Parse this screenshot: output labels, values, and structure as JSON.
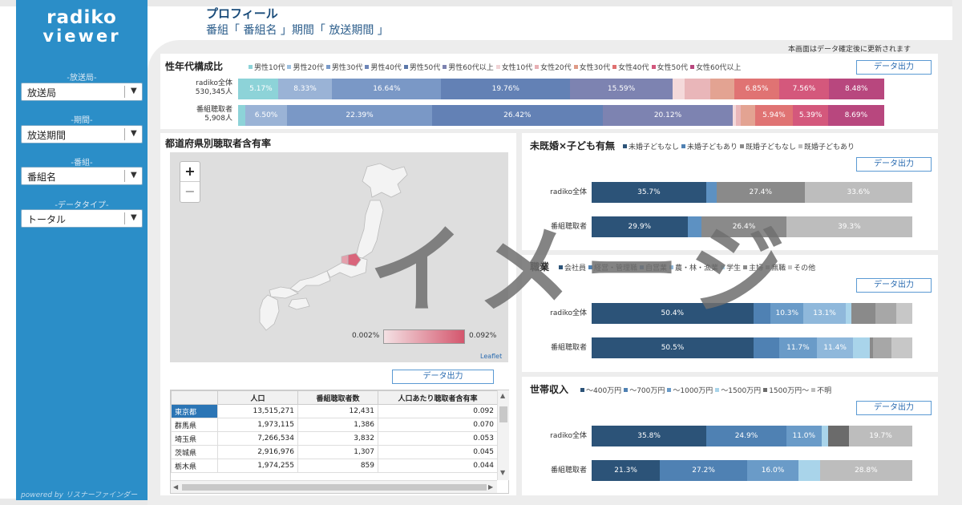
{
  "sidebar": {
    "logo_line1": "radiko",
    "logo_line2": "viewer",
    "filters": [
      {
        "label": "-放送局-",
        "value": "放送局"
      },
      {
        "label": "-期間-",
        "value": "放送期間"
      },
      {
        "label": "-番組-",
        "value": "番組名"
      },
      {
        "label": "-データタイプ-",
        "value": "トータル"
      }
    ],
    "powered_by": "powered by リスナーファインダー"
  },
  "header": {
    "title": "プロフィール",
    "subtitle": "番組「 番組名 」期間「 放送期間 」",
    "update_note": "本画面はデータ確定後に更新されます"
  },
  "export_label": "データ出力",
  "gender_age": {
    "title": "性年代構成比",
    "legend": [
      {
        "label": "男性10代",
        "color": "#8dd3d8"
      },
      {
        "label": "男性20代",
        "color": "#9ec1e0"
      },
      {
        "label": "男性30代",
        "color": "#7a9bc9"
      },
      {
        "label": "男性40代",
        "color": "#6e86b8"
      },
      {
        "label": "男性50代",
        "color": "#5c78aa"
      },
      {
        "label": "男性60代以上",
        "color": "#7c82b0"
      },
      {
        "label": "女性10代",
        "color": "#f0d3d5"
      },
      {
        "label": "女性20代",
        "color": "#e7b0b4"
      },
      {
        "label": "女性30代",
        "color": "#df9a86"
      },
      {
        "label": "女性40代",
        "color": "#e07070"
      },
      {
        "label": "女性50代",
        "color": "#d2567c"
      },
      {
        "label": "女性60代以上",
        "color": "#b8477e"
      }
    ],
    "rows": [
      {
        "label1": "radiko全体",
        "label2": "530,345人",
        "segments": [
          {
            "value": 0.9,
            "label": "",
            "color": "#8dd3d8"
          },
          {
            "value": 5.17,
            "label": "5.17%",
            "color": "#8dd3d8"
          },
          {
            "value": 8.33,
            "label": "8.33%",
            "color": "#9ab3d6"
          },
          {
            "value": 16.64,
            "label": "16.64%",
            "color": "#7a98c6"
          },
          {
            "value": 19.76,
            "label": "19.76%",
            "color": "#6381b5"
          },
          {
            "value": 15.59,
            "label": "15.59%",
            "color": "#7d83b1"
          },
          {
            "value": 1.9,
            "label": "",
            "color": "#f4d9da"
          },
          {
            "value": 3.9,
            "label": "",
            "color": "#e9b6b9"
          },
          {
            "value": 3.7,
            "label": "",
            "color": "#e3a392"
          },
          {
            "value": 6.85,
            "label": "6.85%",
            "color": "#e07373"
          },
          {
            "value": 7.56,
            "label": "7.56%",
            "color": "#d4587c"
          },
          {
            "value": 8.48,
            "label": "8.48%",
            "color": "#b8477e"
          }
        ]
      },
      {
        "label1": "番組聴取者",
        "label2": "5,908人",
        "segments": [
          {
            "value": 1.1,
            "label": "",
            "color": "#8dd3d8"
          },
          {
            "value": 6.5,
            "label": "6.50%",
            "color": "#9ab3d6"
          },
          {
            "value": 22.39,
            "label": "22.39%",
            "color": "#7a98c6"
          },
          {
            "value": 26.42,
            "label": "26.42%",
            "color": "#6381b5"
          },
          {
            "value": 20.12,
            "label": "20.12%",
            "color": "#7d83b1"
          },
          {
            "value": 0.5,
            "label": "",
            "color": "#f4d9da"
          },
          {
            "value": 0.7,
            "label": "",
            "color": "#e9b6b9"
          },
          {
            "value": 2.2,
            "label": "",
            "color": "#e3a392"
          },
          {
            "value": 5.94,
            "label": "5.94%",
            "color": "#e07373"
          },
          {
            "value": 5.39,
            "label": "5.39%",
            "color": "#d4587c"
          },
          {
            "value": 8.69,
            "label": "8.69%",
            "color": "#b8477e"
          }
        ]
      }
    ]
  },
  "prefecture": {
    "title": "都道府県別聴取者含有率",
    "scale_min": "0.002%",
    "scale_max": "0.092%",
    "leaflet": "Leaflet",
    "zoom_in": "+",
    "zoom_out": "−",
    "table_headers": [
      "",
      "人口",
      "番組聴取者数",
      "人口あたり聴取者含有率"
    ],
    "table_rows": [
      [
        "東京都",
        "13,515,271",
        "12,431",
        "0.092"
      ],
      [
        "群馬県",
        "1,973,115",
        "1,386",
        "0.070"
      ],
      [
        "埼玉県",
        "7,266,534",
        "3,832",
        "0.053"
      ],
      [
        "茨城県",
        "2,916,976",
        "1,307",
        "0.045"
      ],
      [
        "栃木県",
        "1,974,255",
        "859",
        "0.044"
      ]
    ]
  },
  "marital": {
    "title": "未既婚×子ども有無",
    "legend": [
      {
        "label": "未婚子どもなし",
        "color": "#2c5378"
      },
      {
        "label": "未婚子どもあり",
        "color": "#4f81b3"
      },
      {
        "label": "既婚子どもなし",
        "color": "#8a8a8a"
      },
      {
        "label": "既婚子どもあり",
        "color": "#bdbdbd"
      }
    ],
    "rows": [
      {
        "label": "radiko全体",
        "segments": [
          {
            "value": 35.7,
            "label": "35.7%",
            "color": "#2c5378"
          },
          {
            "value": 3.3,
            "label": "",
            "color": "#5d91c2"
          },
          {
            "value": 27.4,
            "label": "27.4%",
            "color": "#8a8a8a"
          },
          {
            "value": 33.6,
            "label": "33.6%",
            "color": "#bdbdbd"
          }
        ]
      },
      {
        "label": "番組聴取者",
        "segments": [
          {
            "value": 29.9,
            "label": "29.9%",
            "color": "#2c5378"
          },
          {
            "value": 4.4,
            "label": "",
            "color": "#5d91c2"
          },
          {
            "value": 26.4,
            "label": "26.4%",
            "color": "#8a8a8a"
          },
          {
            "value": 39.3,
            "label": "39.3%",
            "color": "#bdbdbd"
          }
        ]
      }
    ]
  },
  "occupation": {
    "title": "職業",
    "legend": [
      {
        "label": "会社員",
        "color": "#2c5378"
      },
      {
        "label": "経営・管理職",
        "color": "#4f81b3"
      },
      {
        "label": "自営業",
        "color": "#6a9bc8"
      },
      {
        "label": "農・林・漁業",
        "color": "#8fb8db"
      },
      {
        "label": "学生",
        "color": "#a9d4ea"
      },
      {
        "label": "主婦",
        "color": "#8a8a8a"
      },
      {
        "label": "無職",
        "color": "#a7a7a7"
      },
      {
        "label": "その他",
        "color": "#c7c7c7"
      }
    ],
    "rows": [
      {
        "label": "radiko全体",
        "segments": [
          {
            "value": 50.4,
            "label": "50.4%",
            "color": "#2c5378"
          },
          {
            "value": 5.4,
            "label": "",
            "color": "#4f81b3"
          },
          {
            "value": 10.3,
            "label": "10.3%",
            "color": "#6a9bc8"
          },
          {
            "value": 13.1,
            "label": "13.1%",
            "color": "#8fb8db"
          },
          {
            "value": 1.8,
            "label": "",
            "color": "#a9d4ea"
          },
          {
            "value": 7.5,
            "label": "",
            "color": "#8a8a8a"
          },
          {
            "value": 6.5,
            "label": "",
            "color": "#a7a7a7"
          },
          {
            "value": 5.0,
            "label": "",
            "color": "#c7c7c7"
          }
        ]
      },
      {
        "label": "番組聴取者",
        "segments": [
          {
            "value": 50.5,
            "label": "50.5%",
            "color": "#2c5378"
          },
          {
            "value": 8.0,
            "label": "",
            "color": "#4f81b3"
          },
          {
            "value": 11.7,
            "label": "11.7%",
            "color": "#6a9bc8"
          },
          {
            "value": 11.4,
            "label": "11.4%",
            "color": "#8fb8db"
          },
          {
            "value": 5.2,
            "label": "",
            "color": "#a9d4ea"
          },
          {
            "value": 1.0,
            "label": "",
            "color": "#8a8a8a"
          },
          {
            "value": 5.8,
            "label": "",
            "color": "#a7a7a7"
          },
          {
            "value": 6.4,
            "label": "",
            "color": "#c7c7c7"
          }
        ]
      }
    ]
  },
  "income": {
    "title": "世帯収入",
    "legend": [
      {
        "label": "〜400万円",
        "color": "#2c5378"
      },
      {
        "label": "〜700万円",
        "color": "#4f81b3"
      },
      {
        "label": "〜1000万円",
        "color": "#6a9bc8"
      },
      {
        "label": "〜1500万円",
        "color": "#a9d4ea"
      },
      {
        "label": "1500万円〜",
        "color": "#6b6b6b"
      },
      {
        "label": "不明",
        "color": "#bdbdbd"
      }
    ],
    "rows": [
      {
        "label": "radiko全体",
        "segments": [
          {
            "value": 35.8,
            "label": "35.8%",
            "color": "#2c5378"
          },
          {
            "value": 24.9,
            "label": "24.9%",
            "color": "#4f81b3"
          },
          {
            "value": 11.0,
            "label": "11.0%",
            "color": "#6a9bc8"
          },
          {
            "value": 2.0,
            "label": "",
            "color": "#a9d4ea"
          },
          {
            "value": 6.6,
            "label": "",
            "color": "#6b6b6b"
          },
          {
            "value": 19.7,
            "label": "19.7%",
            "color": "#bdbdbd"
          }
        ]
      },
      {
        "label": "番組聴取者",
        "segments": [
          {
            "value": 21.3,
            "label": "21.3%",
            "color": "#2c5378"
          },
          {
            "value": 27.2,
            "label": "27.2%",
            "color": "#4f81b3"
          },
          {
            "value": 16.0,
            "label": "16.0%",
            "color": "#6a9bc8"
          },
          {
            "value": 6.7,
            "label": "",
            "color": "#a9d4ea"
          },
          {
            "value": 0.0,
            "label": "",
            "color": "#6b6b6b"
          },
          {
            "value": 28.8,
            "label": "28.8%",
            "color": "#bdbdbd"
          }
        ]
      }
    ]
  },
  "watermark": "イメージ"
}
